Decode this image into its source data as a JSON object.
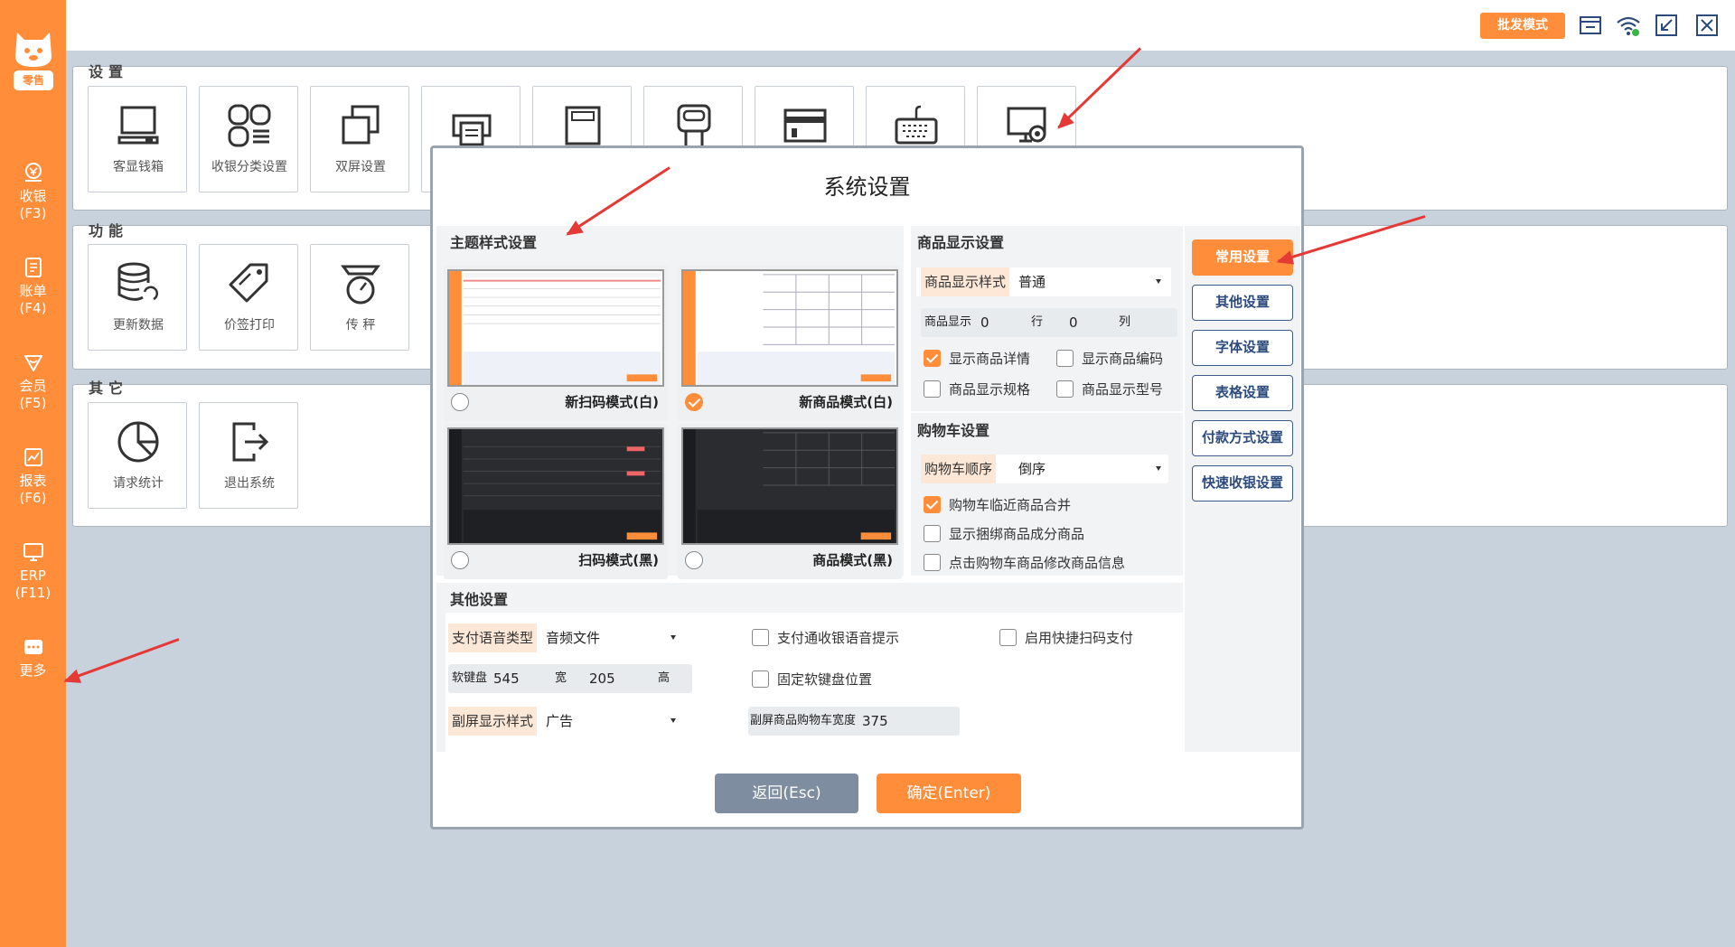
{
  "app": {
    "logo_text": "零售",
    "batch_mode": "批发模式"
  },
  "sidebar": {
    "items": [
      {
        "label": "收银",
        "key": "(F3)"
      },
      {
        "label": "账单",
        "key": "(F4)"
      },
      {
        "label": "会员",
        "key": "(F5)"
      },
      {
        "label": "报表",
        "key": "(F6)"
      },
      {
        "label": "ERP",
        "key": "(F11)"
      },
      {
        "label": "更多",
        "key": ""
      }
    ]
  },
  "panels": {
    "settings": {
      "title": "设置",
      "tiles": [
        "客显钱箱",
        "收银分类设置",
        "双屏设置"
      ]
    },
    "functions": {
      "title": "功能",
      "tiles": [
        "更新数据",
        "价签打印",
        "传 秤"
      ]
    },
    "others": {
      "title": "其它",
      "tiles": [
        "请求统计",
        "退出系统"
      ]
    }
  },
  "modal": {
    "title": "系统设置",
    "theme": {
      "title": "主题样式设置",
      "cards": [
        {
          "name": "新扫码模式(白)",
          "selected": false
        },
        {
          "name": "新商品模式(白)",
          "selected": true
        },
        {
          "name": "扫码模式(黑)",
          "selected": false
        },
        {
          "name": "商品模式(黑)",
          "selected": false
        }
      ]
    },
    "product_display": {
      "title": "商品显示设置",
      "style_label": "商品显示样式",
      "style_value": "普通",
      "grid_label": "商品显示",
      "rows_value": "0",
      "rows_label": "行",
      "cols_value": "0",
      "cols_label": "列",
      "checks": [
        {
          "label": "显示商品详情",
          "checked": true
        },
        {
          "label": "显示商品编码",
          "checked": false
        },
        {
          "label": "商品显示规格",
          "checked": false
        },
        {
          "label": "商品显示型号",
          "checked": false
        }
      ]
    },
    "cart": {
      "title": "购物车设置",
      "order_label": "购物车顺序",
      "order_value": "倒序",
      "checks": [
        {
          "label": "购物车临近商品合并",
          "checked": true
        },
        {
          "label": "显示捆绑商品成分商品",
          "checked": false
        },
        {
          "label": "点击购物车商品修改商品信息",
          "checked": false
        }
      ]
    },
    "other": {
      "title": "其他设置",
      "voice_label": "支付语音类型",
      "voice_value": "音频文件",
      "keyboard_label": "软键盘",
      "keyboard_width": "545",
      "width_label": "宽",
      "keyboard_height": "205",
      "height_label": "高",
      "sub_label": "副屏显示样式",
      "sub_value": "广告",
      "checks": [
        {
          "label": "支付通收银语音提示",
          "checked": false
        },
        {
          "label": "启用快捷扫码支付",
          "checked": false
        },
        {
          "label": "固定软键盘位置",
          "checked": false
        }
      ],
      "cart_width_label": "副屏商品购物车宽度",
      "cart_width_value": "375"
    },
    "side_buttons": [
      "常用设置",
      "其他设置",
      "字体设置",
      "表格设置",
      "付款方式设置",
      "快速收银设置"
    ],
    "back": "返回(Esc)",
    "ok": "确定(Enter)"
  },
  "colors": {
    "accent": "#ff8d3a",
    "navy": "#2c4a7c",
    "arrow": "#e53935"
  }
}
